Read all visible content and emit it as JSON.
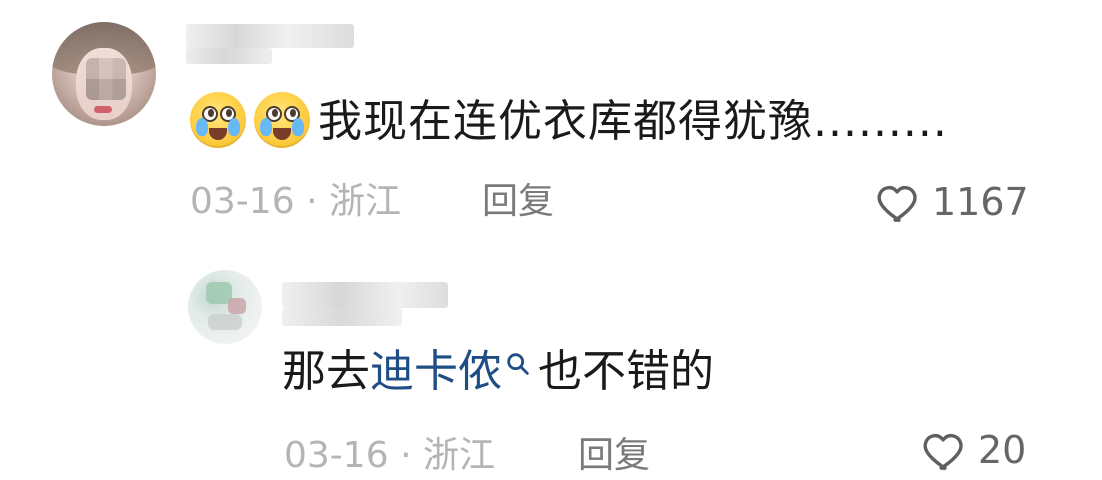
{
  "comments": [
    {
      "text": "我现在连优衣库都得犹豫.........",
      "date": "03-16",
      "separator": "·",
      "location": "浙江",
      "reply_label": "回复",
      "like_count": "1167",
      "emojis": [
        "crying-face-emoji",
        "crying-face-emoji"
      ]
    },
    {
      "text_prefix": "那去",
      "link_text": "迪卡侬",
      "text_suffix": "也不错的",
      "date": "03-16",
      "separator": "·",
      "location": "浙江",
      "reply_label": "回复",
      "like_count": "20"
    }
  ],
  "icons": {
    "heart": "heart-icon",
    "search": "search-icon"
  },
  "colors": {
    "background": "#ffffff",
    "text_primary": "#1a1a1a",
    "meta_gray": "#b4b4b4",
    "reply_gray": "#7a7a7a",
    "like_gray": "#666666",
    "link_blue": "#1f4e86"
  }
}
